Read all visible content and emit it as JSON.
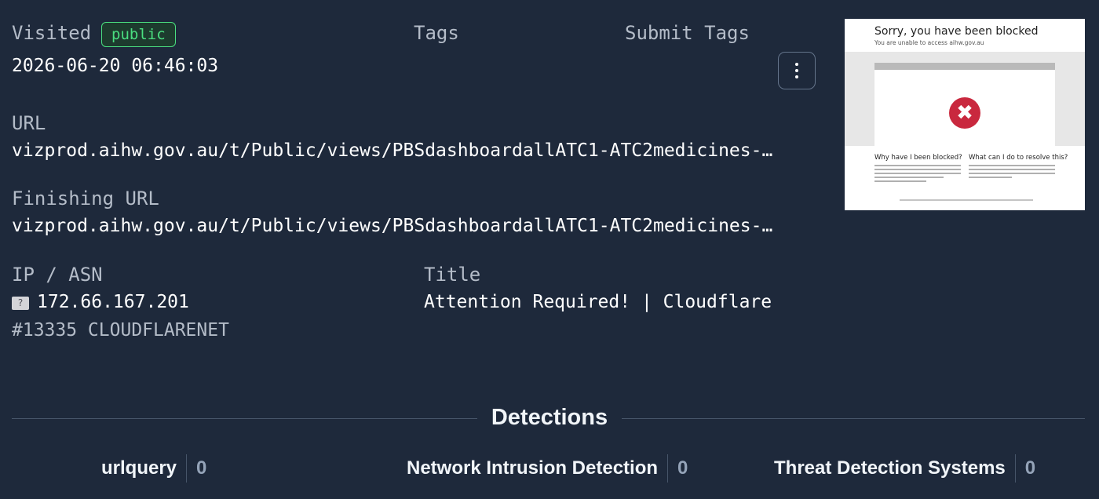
{
  "visited": {
    "label": "Visited",
    "badge": "public",
    "timestamp": "2026-06-20 06:46:03"
  },
  "tags": {
    "label": "Tags",
    "submit_label": "Submit Tags"
  },
  "url": {
    "label": "URL",
    "value": "vizprod.aihw.gov.au/t/Public/views/PBSdashboardallATC1-ATC2medicines-…"
  },
  "finishing_url": {
    "label": "Finishing URL",
    "value": "vizprod.aihw.gov.au/t/Public/views/PBSdashboardallATC1-ATC2medicines-…"
  },
  "ip_asn": {
    "label": "IP / ASN",
    "flag": "?",
    "ip": "172.66.167.201",
    "asn": "#13335 CLOUDFLARENET"
  },
  "title": {
    "label": "Title",
    "value": "Attention Required! | Cloudflare"
  },
  "screenshot": {
    "heading": "Sorry, you have been blocked",
    "subheading": "You are unable to access aihw.gov.au",
    "why_heading": "Why have I been blocked?",
    "resolve_heading": "What can I do to resolve this?",
    "error_glyph": "✖"
  },
  "detections": {
    "title": "Detections",
    "items": [
      {
        "name": "urlquery",
        "count": "0"
      },
      {
        "name": "Network Intrusion Detection",
        "count": "0"
      },
      {
        "name": "Threat Detection Systems",
        "count": "0"
      }
    ]
  },
  "colors": {
    "background": "#1e293b",
    "badge_green": "#4ade80",
    "error_red": "#c9283e"
  }
}
